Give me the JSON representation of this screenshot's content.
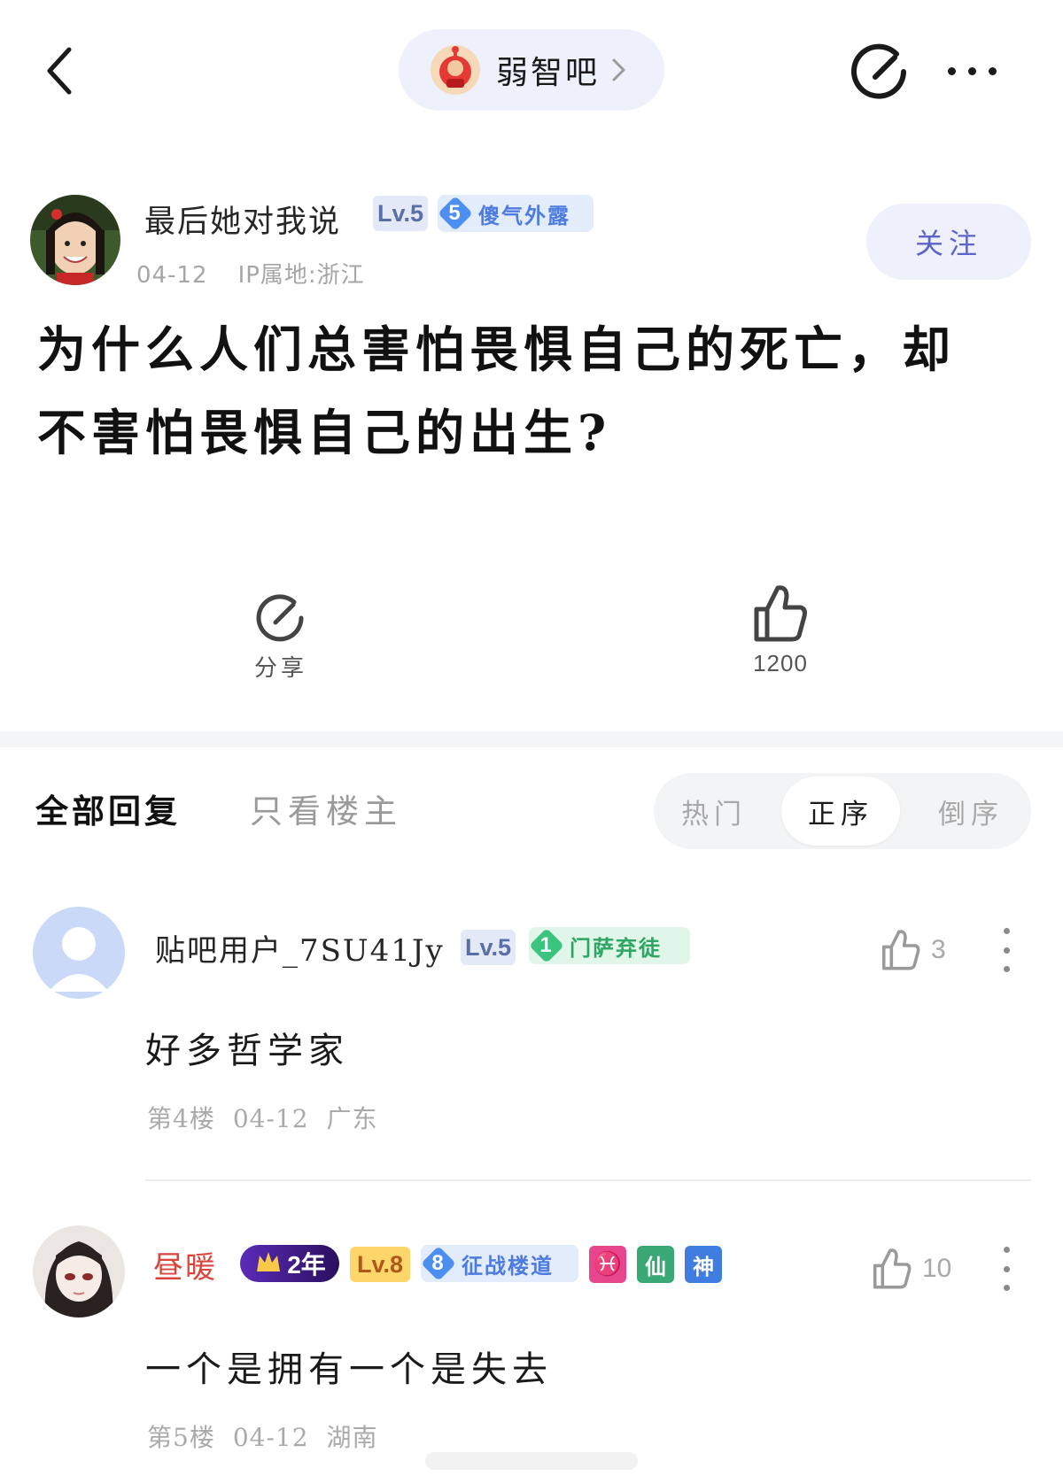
{
  "header": {
    "forum_name": "弱智吧"
  },
  "author": {
    "name": "最后她对我说",
    "level": "Lv.5",
    "title_level": "5",
    "title": "傻气外露",
    "date": "04-12",
    "ip": "IP属地:浙江",
    "follow_label": "关注"
  },
  "post": {
    "title_line1": "为什么人们总害怕畏惧自己的死亡，却",
    "title_line2": "不害怕畏惧自己的出生?"
  },
  "actions": {
    "share_label": "分享",
    "like_count": "1200"
  },
  "tabs": {
    "all": "全部回复",
    "op_only": "只看楼主",
    "sort": [
      "热门",
      "正序",
      "倒序"
    ],
    "active_sort": "正序"
  },
  "replies": [
    {
      "name": "贴吧用户_7SU41Jy",
      "level": "Lv.5",
      "title_level": "1",
      "title": "门萨弃徒",
      "likes": "3",
      "content": "好多哲学家",
      "floor": "第4楼",
      "date": "04-12",
      "location": "广东"
    },
    {
      "name": "昼暖",
      "years": "2年",
      "level": "Lv.8",
      "title_level": "8",
      "title": "征战楼道",
      "icons": [
        "♓",
        "仙",
        "神"
      ],
      "likes": "10",
      "content": "一个是拥有一个是失去",
      "floor": "第5楼",
      "date": "04-12",
      "location": "湖南"
    }
  ],
  "colors": {
    "accent": "#5d63c8",
    "pill_bg": "#eef0fb",
    "meta_gray": "#a6a6a6",
    "badge_blue": "#4d8ff0",
    "badge_green": "#3bc47e",
    "vip_red": "#d9453d"
  }
}
